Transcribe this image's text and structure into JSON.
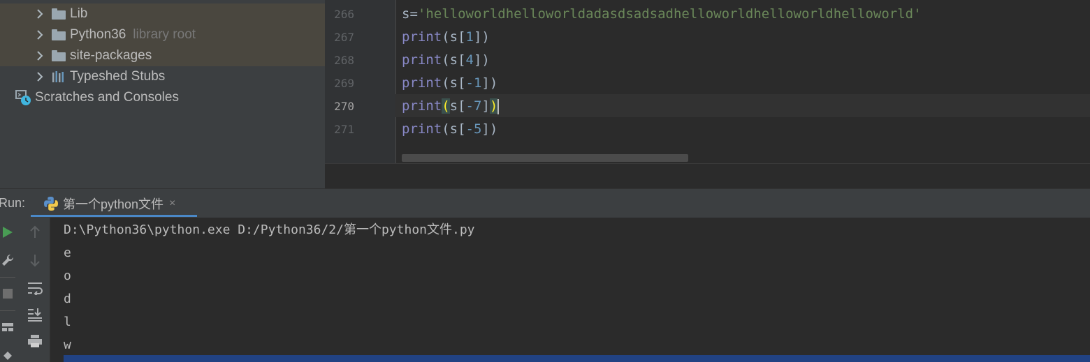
{
  "project_tree": {
    "items": [
      {
        "label": "Lib",
        "hint": ""
      },
      {
        "label": "Python36",
        "hint": "library root"
      },
      {
        "label": "site-packages",
        "hint": ""
      },
      {
        "label": "Typeshed Stubs",
        "hint": ""
      },
      {
        "label": "Scratches and Consoles",
        "hint": ""
      }
    ]
  },
  "editor": {
    "current_line": "270",
    "lines": [
      {
        "number": "266",
        "var": "s",
        "eq": "=",
        "string": "'helloworldhelloworldadasdsadsadhelloworldhelloworldhelloworld'"
      },
      {
        "number": "267",
        "fn": "print",
        "open": "(s[",
        "index": "1",
        "close": "])"
      },
      {
        "number": "268",
        "fn": "print",
        "open": "(s[",
        "index": "4",
        "close": "])"
      },
      {
        "number": "269",
        "fn": "print",
        "open": "(s[",
        "index": "-1",
        "close": "])"
      },
      {
        "number": "270",
        "fn": "print",
        "open": "(",
        "mid": "s[",
        "index": "-7",
        "close_bracket": "]",
        "close": ")"
      },
      {
        "number": "271",
        "fn": "print",
        "open": "(s[",
        "index": "-5",
        "close": "])"
      }
    ]
  },
  "run_panel": {
    "label": "Run:",
    "tab_title": "第一个python文件",
    "tab_close": "×",
    "console_lines": [
      "D:\\Python36\\python.exe D:/Python36/2/第一个python文件.py",
      "e",
      "o",
      "d",
      "l",
      "w"
    ]
  },
  "colors": {
    "keyword_fn": "#8888c6",
    "string": "#6a8759",
    "number": "#6897bb",
    "selection": "#214283",
    "tab_underline": "#4a88c7"
  },
  "icons": [
    "chevron-right-icon",
    "folder-icon",
    "stubs-icon",
    "scratches-icon",
    "python-icon",
    "run-icon",
    "wrench-icon",
    "stop-icon",
    "up-arrow-icon",
    "down-arrow-icon",
    "soft-wrap-icon",
    "scroll-to-end-icon",
    "print-icon",
    "layout-icon",
    "pin-icon"
  ]
}
